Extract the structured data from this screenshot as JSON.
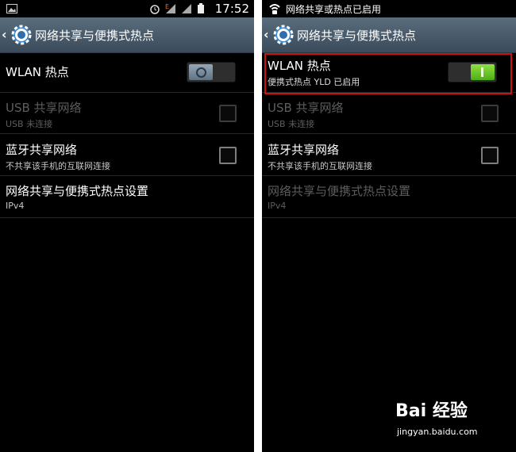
{
  "left": {
    "status_time": "17:52",
    "title": "网络共享与便携式热点",
    "wlan": {
      "label": "WLAN 热点",
      "enabled": false
    },
    "usb": {
      "label": "USB 共享网络",
      "sub": "USB 未连接"
    },
    "bt": {
      "label": "蓝牙共享网络",
      "sub": "不共享该手机的互联网连接"
    },
    "settings": {
      "label": "网络共享与便携式热点设置",
      "sub": "IPv4"
    }
  },
  "right": {
    "notification": "网络共享或热点已启用",
    "title": "网络共享与便携式热点",
    "wlan": {
      "label": "WLAN 热点",
      "sub": "便携式热点 YLD 已启用",
      "enabled": true
    },
    "usb": {
      "label": "USB 共享网络",
      "sub": "USB 未连接"
    },
    "bt": {
      "label": "蓝牙共享网络",
      "sub": "不共享该手机的互联网连接"
    },
    "settings": {
      "label": "网络共享与便携式热点设置",
      "sub": "IPv4"
    }
  },
  "watermark": {
    "brand": "Bai 经验",
    "url": "jingyan.baidu.com"
  },
  "colors": {
    "highlight": "#cc1111",
    "toggle_on": "#6fcf2a",
    "title_bar": "#4b5e6e"
  }
}
